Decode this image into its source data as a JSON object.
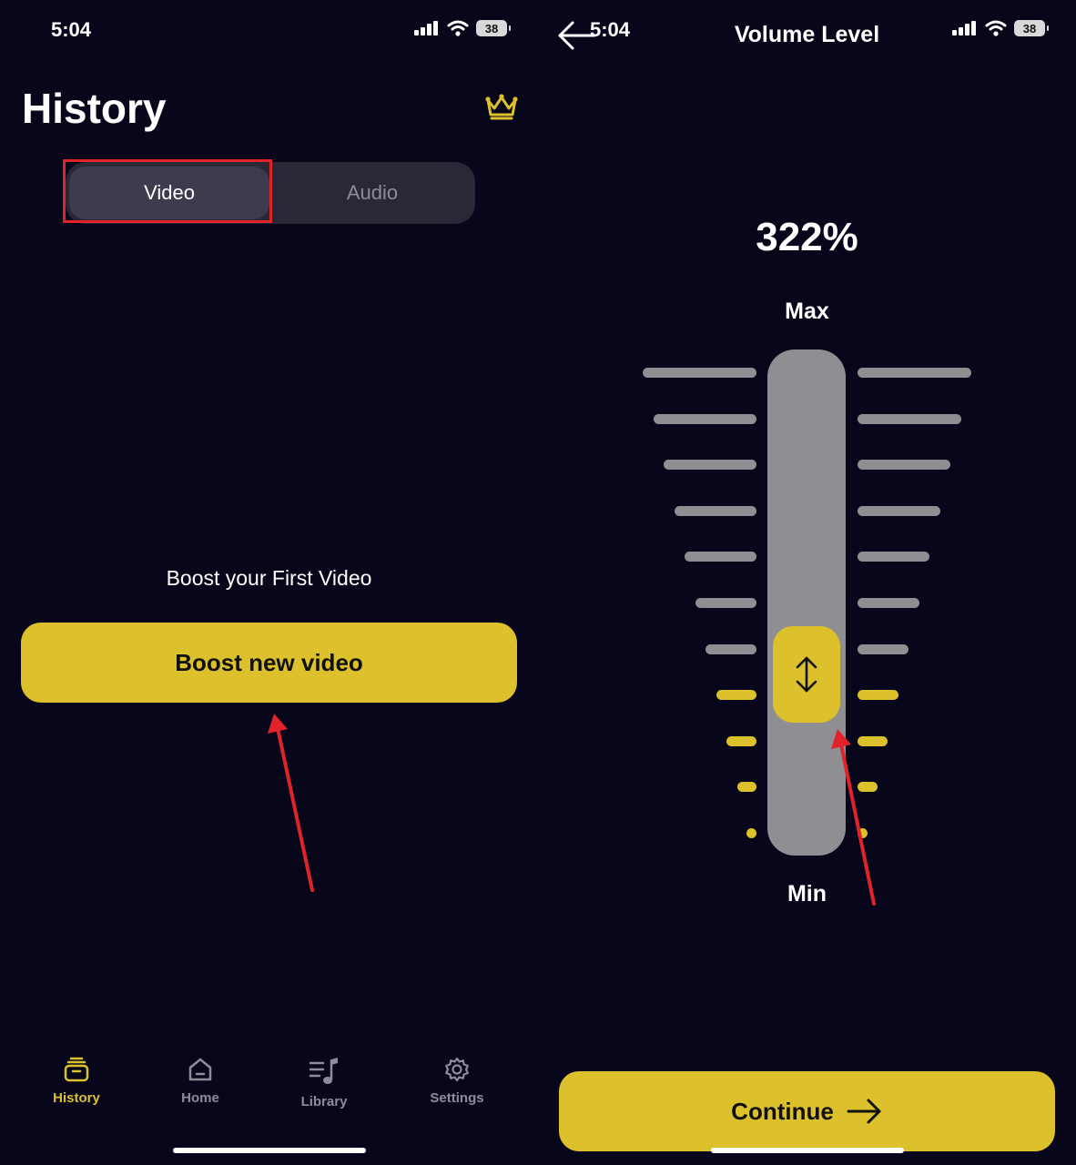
{
  "left_screen": {
    "status_bar": {
      "time": "5:04",
      "battery": "38"
    },
    "title": "History",
    "premium_icon": "crown-icon",
    "segmented_control": {
      "selected": "Video",
      "options": [
        "Video",
        "Audio"
      ]
    },
    "empty_state": {
      "message": "Boost your First Video"
    },
    "primary_button": {
      "label": "Boost new video"
    },
    "tab_bar": {
      "active": "History",
      "items": [
        {
          "label": "History",
          "icon": "history-stack-icon"
        },
        {
          "label": "Home",
          "icon": "home-icon"
        },
        {
          "label": "Library",
          "icon": "music-library-icon"
        },
        {
          "label": "Settings",
          "icon": "gear-icon"
        }
      ]
    }
  },
  "right_screen": {
    "status_bar": {
      "time": "5:04",
      "battery": "38"
    },
    "title": "Volume Level",
    "volume_value": "322%",
    "slider": {
      "max_label": "Max",
      "min_label": "Min",
      "level_fraction": 0.32,
      "active_ticks": 4,
      "total_ticks": 11
    },
    "primary_button": {
      "label": "Continue"
    }
  },
  "colors": {
    "background": "#07061a",
    "accent": "#dcc12c",
    "inactive": "#8e8e93",
    "annotation": "#e0222a"
  }
}
